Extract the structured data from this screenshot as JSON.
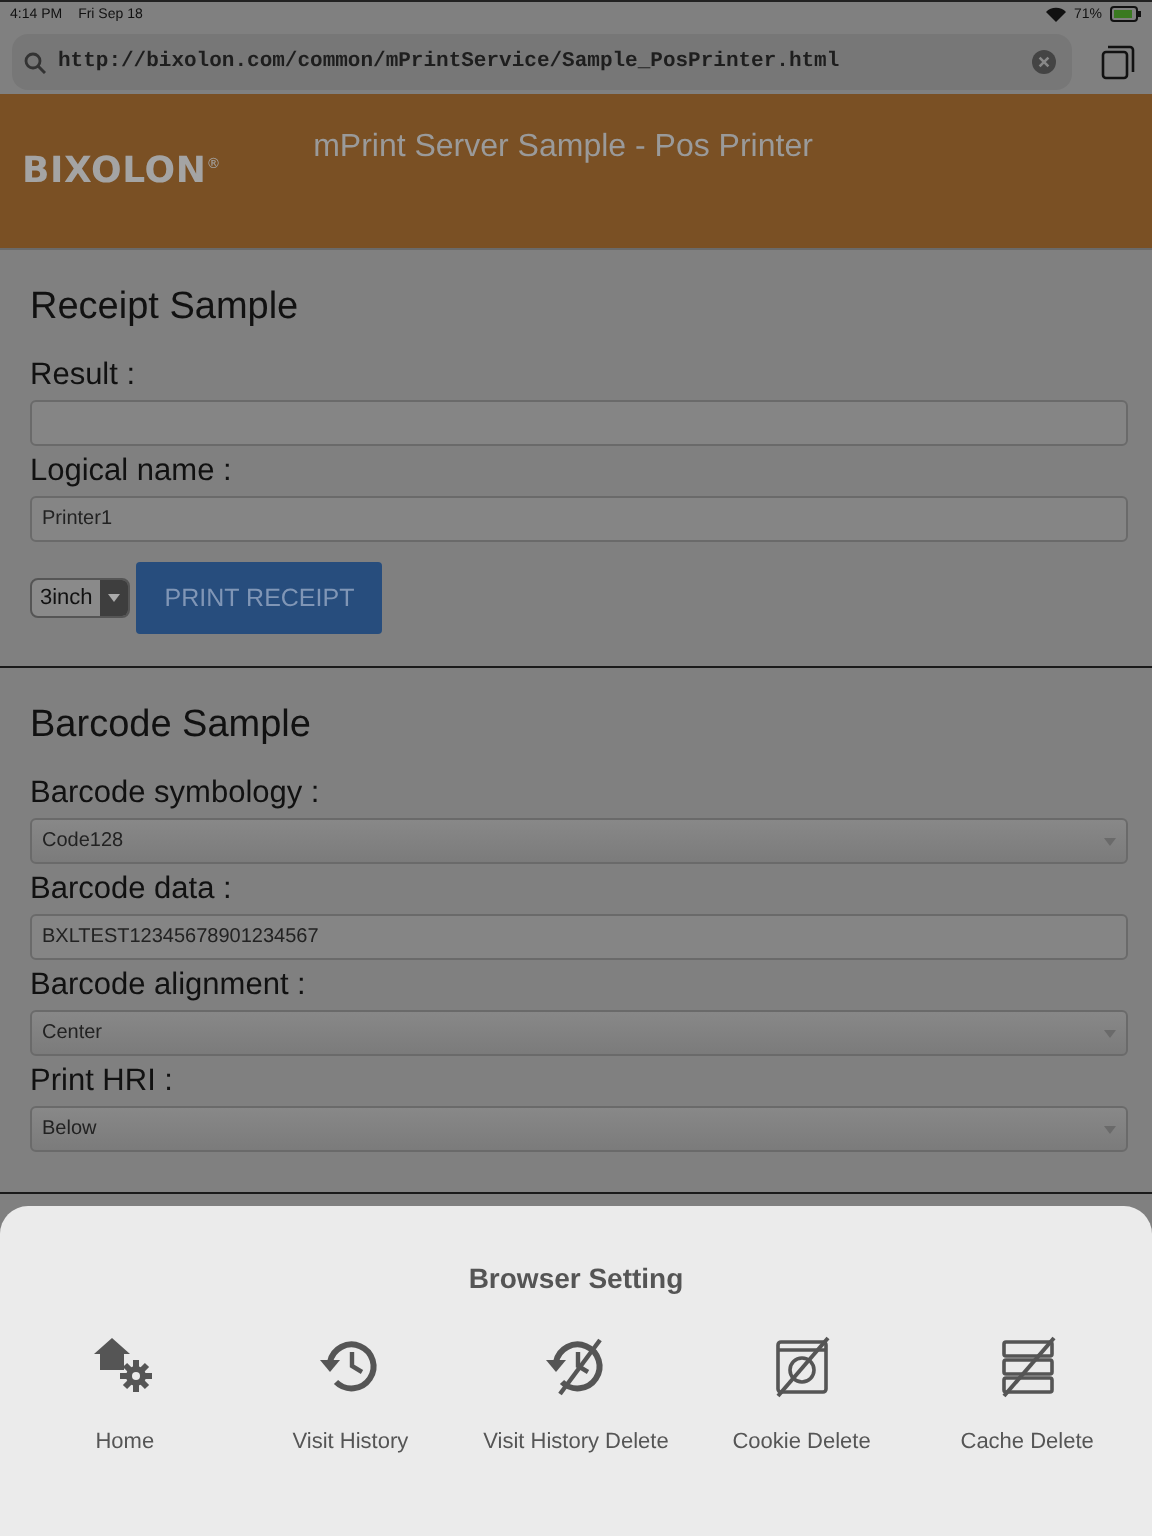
{
  "status_bar": {
    "time": "4:14 PM",
    "date": "Fri Sep 18",
    "battery": "71%"
  },
  "address_bar": {
    "url": "http://bixolon.com/common/mPrintService/Sample_PosPrinter.html"
  },
  "header": {
    "logo": "BIXOLON$^{®}$",
    "title": "mPrint Server Sample - Pos Printer"
  },
  "sections": [
    {
      "title": "Receipt Sample",
      "fields": [
        {
          "kind": "input",
          "label": "Result :"
        },
        {
          "kind": "input",
          "label": "Logical name :",
          "value": "Printer1"
        }
      ],
      "actions": {
        "size": "3inch",
        "button": "PRINT RECEIPT"
      }
    },
    {
      "title": "Barcode Sample",
      "fields": [
        {
          "kind": "select",
          "label": "Barcode symbology :",
          "value": "Code128"
        },
        {
          "kind": "input",
          "label": "Barcode data :",
          "value": "BXLTEST12345678901234567"
        },
        {
          "kind": "select",
          "label": "Barcode alignment :",
          "value": "Center"
        },
        {
          "kind": "select",
          "label": "Print HRI :",
          "value": "Below"
        }
      ]
    }
  ],
  "sheet": {
    "title": "Browser Setting",
    "items": [
      {
        "kind": "home",
        "label": "Home"
      },
      {
        "kind": "history",
        "label": "Visit History"
      },
      {
        "kind": "history-delete",
        "label": "Visit History Delete"
      },
      {
        "kind": "cookie-delete",
        "label": "Cookie Delete"
      },
      {
        "kind": "cache-delete",
        "label": "Cache Delete"
      }
    ]
  }
}
